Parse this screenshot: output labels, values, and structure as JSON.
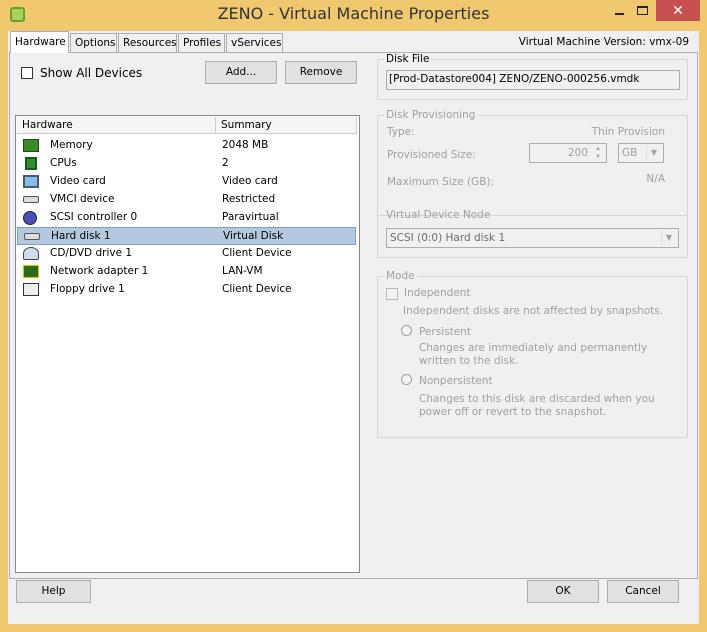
{
  "window": {
    "title": "ZENO - Virtual Machine Properties",
    "close": "✕"
  },
  "tabs": [
    "Hardware",
    "Options",
    "Resources",
    "Profiles",
    "vServices"
  ],
  "version": "Virtual Machine Version: vmx-09",
  "show_all_devices": "Show All Devices",
  "add_label": "Add...",
  "remove_label": "Remove",
  "columns": [
    "Hardware",
    "Summary"
  ],
  "devices": [
    {
      "name": "Memory",
      "summary": "2048 MB",
      "icon": "memory-icon"
    },
    {
      "name": "CPUs",
      "summary": "2",
      "icon": "cpu-icon"
    },
    {
      "name": "Video card",
      "summary": "Video card",
      "icon": "monitor-icon"
    },
    {
      "name": "VMCI device",
      "summary": "Restricted",
      "icon": "device-icon"
    },
    {
      "name": "SCSI controller 0",
      "summary": "Paravirtual",
      "icon": "scsi-icon"
    },
    {
      "name": "Hard disk 1",
      "summary": "Virtual Disk",
      "icon": "harddisk-icon"
    },
    {
      "name": "CD/DVD drive 1",
      "summary": "Client Device",
      "icon": "cdrom-icon"
    },
    {
      "name": "Network adapter 1",
      "summary": "LAN-VM",
      "icon": "network-icon"
    },
    {
      "name": "Floppy drive 1",
      "summary": "Client Device",
      "icon": "floppy-icon"
    }
  ],
  "disk_file": {
    "legend": "Disk File",
    "value": "[Prod-Datastore004] ZENO/ZENO-000256.vmdk"
  },
  "provisioning": {
    "legend": "Disk Provisioning",
    "type_label": "Type:",
    "type_value": "Thin Provision",
    "size_label": "Provisioned Size:",
    "size_value": "200",
    "unit": "GB",
    "max_label": "Maximum Size (GB):",
    "max_value": "N/A"
  },
  "vdn": {
    "legend": "Virtual Device Node",
    "value": "SCSI (0:0) Hard disk 1"
  },
  "mode": {
    "legend": "Mode",
    "independent": "Independent",
    "independent_note": "Independent disks are not affected by snapshots.",
    "persistent": "Persistent",
    "persistent_note": "Changes are immediately and permanently written to the disk.",
    "nonpersistent": "Nonpersistent",
    "nonpersistent_note": "Changes to this disk are discarded when you power off or revert to the snapshot."
  },
  "footer": {
    "help": "Help",
    "ok": "OK",
    "cancel": "Cancel"
  }
}
